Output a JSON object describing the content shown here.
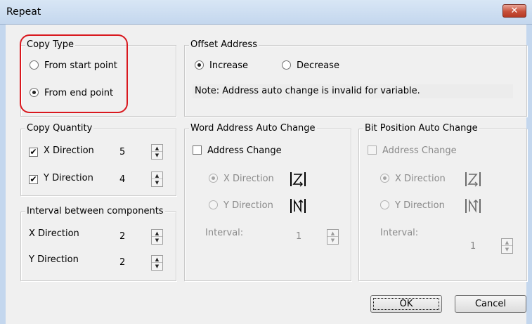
{
  "window": {
    "title": "Repeat",
    "close_label": "✕"
  },
  "copy_type": {
    "label": "Copy Type",
    "options": [
      {
        "label": "From start point",
        "checked": false
      },
      {
        "label": "From end point",
        "checked": true
      }
    ]
  },
  "offset_address": {
    "label": "Offset Address",
    "options": [
      {
        "label": "Increase",
        "checked": true
      },
      {
        "label": "Decrease",
        "checked": false
      }
    ],
    "note": "Note: Address auto change is invalid for variable."
  },
  "copy_quantity": {
    "label": "Copy Quantity",
    "x": {
      "label": "X Direction",
      "checked": true,
      "value": "5"
    },
    "y": {
      "label": "Y Direction",
      "checked": true,
      "value": "4"
    }
  },
  "interval_components": {
    "label": "Interval between components",
    "x": {
      "label": "X Direction",
      "value": "2"
    },
    "y": {
      "label": "Y Direction",
      "value": "2"
    }
  },
  "word_address": {
    "label": "Word Address Auto Change",
    "address_change": {
      "label": "Address Change",
      "checked": false
    },
    "x_direction": {
      "label": "X Direction",
      "checked": true
    },
    "y_direction": {
      "label": "Y Direction",
      "checked": false
    },
    "interval_label": "Interval:",
    "interval_value": "1"
  },
  "bit_position": {
    "label": "Bit Position Auto Change",
    "address_change": {
      "label": "Address Change",
      "checked": false
    },
    "x_direction": {
      "label": "X Direction",
      "checked": true
    },
    "y_direction": {
      "label": "Y Direction",
      "checked": false
    },
    "interval_label": "Interval:",
    "interval_value": "1"
  },
  "buttons": {
    "ok": "OK",
    "cancel": "Cancel"
  },
  "icons": {
    "close": "close-icon",
    "spin_up": "spin-up-arrow-icon",
    "spin_down": "spin-down-arrow-icon",
    "z_order": "z-order-direction-icon",
    "n_order": "n-order-direction-icon"
  },
  "colors": {
    "highlight": "#d9181e",
    "title_bar": "#c4d7ee",
    "dialog_bg": "#f0f0f0"
  }
}
